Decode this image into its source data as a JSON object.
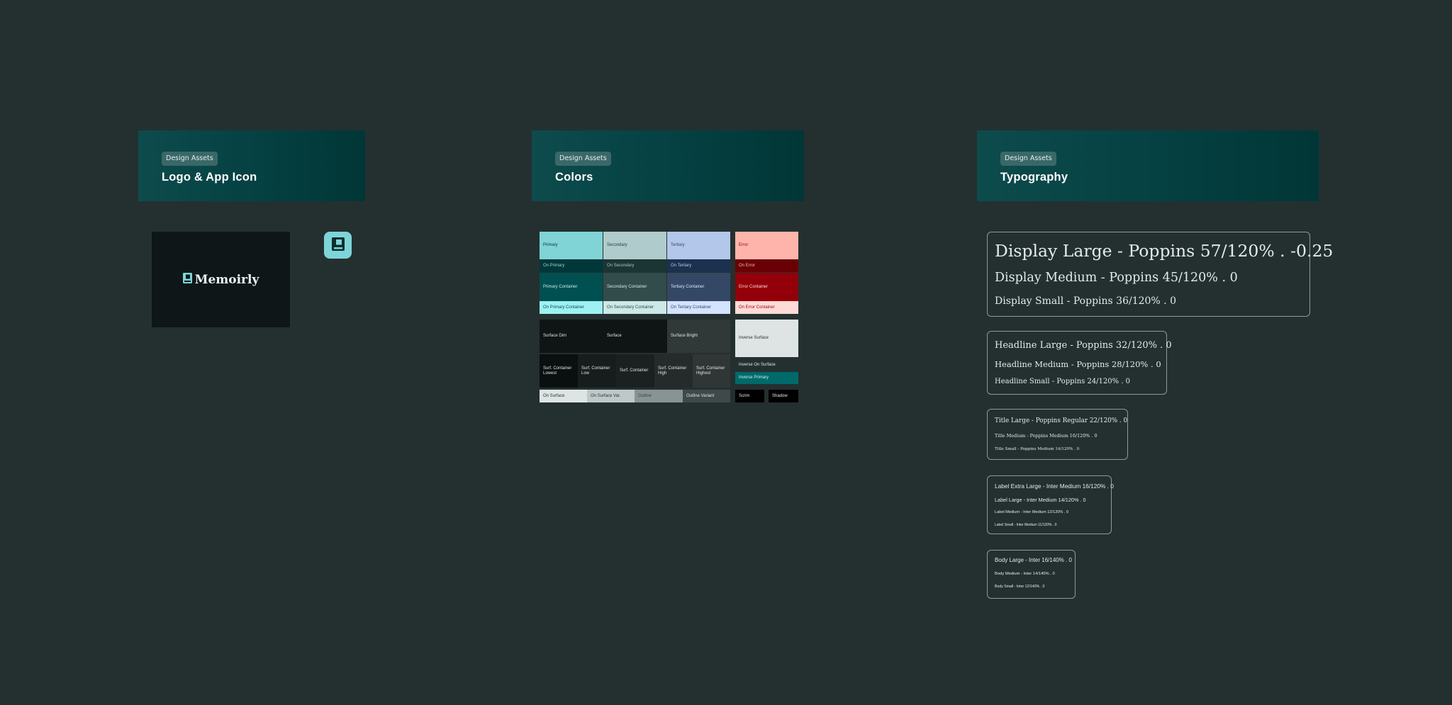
{
  "sections": {
    "logo": {
      "badge": "Design Assets",
      "title": "Logo & App Icon"
    },
    "colors": {
      "badge": "Design Assets",
      "title": "Colors"
    },
    "typography": {
      "badge": "Design Assets",
      "title": "Typography"
    }
  },
  "logo": {
    "wordmark": "Memoirly",
    "icon": "book-icon"
  },
  "palette": {
    "primary": "Primary",
    "on_primary": "On Primary",
    "primary_container": "Primary Container",
    "on_primary_container": "On Primary Container",
    "secondary": "Secondary",
    "on_secondary": "On Secondary",
    "secondary_container": "Secondary Container",
    "on_secondary_container": "On Secondary Container",
    "tertiary": "Tertiary",
    "on_tertiary": "On Tertiary",
    "tertiary_container": "Tertiary Container",
    "on_tertiary_container": "On Tertiary Container",
    "error": "Error",
    "on_error": "On Error",
    "error_container": "Error Container",
    "on_error_container": "On Error Container",
    "surface_dim": "Surface Dim",
    "surface": "Surface",
    "surface_bright": "Surface Bright",
    "surf_container_lowest": "Surf. Container Lowest",
    "surf_container_low": "Surf. Container Low",
    "surf_container": "Surf. Container",
    "surf_container_high": "Surf. Container High",
    "surf_container_highest": "Surf. Container Highest",
    "on_surface": "On Surface",
    "on_surface_var": "On Surface Var.",
    "outline": "Outline",
    "outline_variant": "Outline Variant",
    "inverse_surface": "Inverse Surface",
    "inverse_on_surface": "Inverse On Surface",
    "inverse_primary": "Inverse Primary",
    "scrim": "Scrim",
    "shadow": "Shadow"
  },
  "colors": {
    "background": "#243030",
    "primary": "#80d4d6",
    "on_primary": "#003738",
    "primary_container": "#004f51",
    "on_primary_container": "#9ef1f3",
    "secondary": "#b0cbcb",
    "secondary_container": "#324b4b",
    "on_secondary_container": "#cce8e7",
    "tertiary": "#b3c7ea",
    "on_tertiary": "#1b314e",
    "tertiary_container": "#344865",
    "on_tertiary_container": "#d4e3ff",
    "error": "#ffb4ab",
    "on_error": "#690005",
    "error_container": "#93000a",
    "on_error_container": "#ffdad6",
    "inverse_surface": "#dde4e3",
    "inverse_primary": "#006a6a"
  },
  "typography": {
    "display": [
      "Display Large - Poppins 57/120% . -0.25",
      "Display Medium - Poppins 45/120% . 0",
      "Display Small - Poppins 36/120% . 0"
    ],
    "headline": [
      "Headline Large - Poppins 32/120% . 0",
      "Headline Medium - Poppins 28/120% . 0",
      "Headline Small - Poppins 24/120% . 0"
    ],
    "title": [
      "Title Large - Poppins Regular 22/120% . 0",
      "Title Medium - Poppins Medium 16/120% . 0",
      "Title Small - Poppins Medium 14/120% . 0"
    ],
    "label": [
      "Label Extra Large - Inter Medium 16/120% . 0",
      "Label Large - Inter Medium 14/120% . 0",
      "Label Medium - Inter Medium 12/120% . 0",
      "Label Small - Inter Medium 11/120% . 0"
    ],
    "body": [
      "Body Large - Inter 16/140% . 0",
      "Body Medium - Inter 14/140% . 0",
      "Body Small - Inter 12/140% . 0"
    ]
  }
}
